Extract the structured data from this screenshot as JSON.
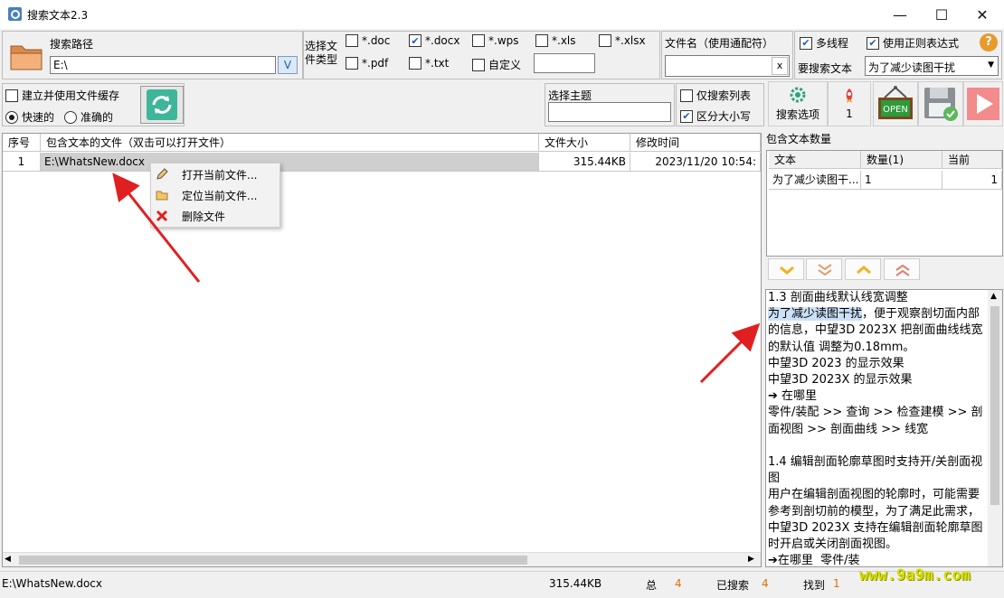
{
  "window": {
    "title": "搜索文本2.3",
    "minimize": "—",
    "maximize": "☐",
    "close": "✕"
  },
  "search_path": {
    "label": "搜索路径",
    "value": "E:\\",
    "dropdown_glyph": "V"
  },
  "file_types": {
    "label": "选择文件类型",
    "items": [
      {
        "label": "*.doc",
        "checked": false
      },
      {
        "label": "*.docx",
        "checked": true
      },
      {
        "label": "*.wps",
        "checked": false
      },
      {
        "label": "*.xls",
        "checked": false
      },
      {
        "label": "*.xlsx",
        "checked": false
      },
      {
        "label": "*.pdf",
        "checked": false
      },
      {
        "label": "*.txt",
        "checked": false
      },
      {
        "label": "自定义",
        "checked": false
      }
    ],
    "custom_value": ""
  },
  "filename_filter": {
    "label": "文件名（使用通配符）",
    "value": "",
    "clear": "x"
  },
  "options": {
    "multithread": {
      "label": "多线程",
      "checked": true
    },
    "regex": {
      "label": "使用正则表达式",
      "checked": true
    },
    "help": "?",
    "search_text_label": "要搜索文本",
    "search_text_value": "为了减少读图干扰"
  },
  "cache": {
    "label": "建立并使用文件缓存",
    "checked": false,
    "fast": "快速的",
    "accurate": "准确的",
    "mode": "fast"
  },
  "theme": {
    "label": "选择主题",
    "value": ""
  },
  "list_opts": {
    "only_list": {
      "label": "仅搜索列表",
      "checked": false
    },
    "case_sensitive": {
      "label": "区分大小写",
      "checked": true
    }
  },
  "toolbar": {
    "search_options": "搜索选项",
    "count": "1",
    "open_sign": "OPEN"
  },
  "results": {
    "columns": [
      "序号",
      "包含文本的文件（双击可以打开文件）",
      "文件大小",
      "修改时间"
    ],
    "rows": [
      {
        "index": "1",
        "file": "E:\\WhatsNew.docx",
        "size": "315.44KB",
        "modified": "2023/11/20 10:54:"
      }
    ]
  },
  "context_menu": {
    "items": [
      {
        "label": "打开当前文件...",
        "icon": "pencil-icon"
      },
      {
        "label": "定位当前文件...",
        "icon": "folder-icon"
      },
      {
        "label": "删除文件",
        "icon": "delete-x-icon"
      }
    ]
  },
  "count_panel": {
    "title": "包含文本数量",
    "columns": [
      "文本",
      "数量(1)",
      "当前"
    ],
    "rows": [
      {
        "text": "为了减少读图干...",
        "count": "1",
        "current": "1"
      }
    ]
  },
  "nav_buttons": [
    "chevron-down",
    "double-chevron-down",
    "chevron-up",
    "double-chevron-up"
  ],
  "text_preview": {
    "before": "1.3 剖面曲线默认线宽调整\n",
    "highlight": "为了减少读图干扰",
    "after": "，便于观察剖切面内部的信息，中望3D 2023X 把剖面曲线线宽的默认值 调整为0.18mm。\n中望3D 2023 的显示效果\n中望3D 2023X 的显示效果\n➔ 在哪里\n零件/装配 >> 查询 >> 检查建模 >> 剖面视图 >> 剖面曲线 >> 线宽\n\n1.4 编辑剖面轮廓草图时支持开/关剖面视图\n用户在编辑剖面视图的轮廓时，可能需要参考到剖切前的模型，为了满足此需求，中望3D 2023X 支持在编辑剖面轮廓草图时开启或关闭剖面视图。\n➔在哪里  零件/装"
  },
  "status": {
    "path": "E:\\WhatsNew.docx",
    "size": "315.44KB",
    "total_label": "总",
    "total": "4",
    "searched_label": "已搜索",
    "searched": "4",
    "found_label": "找到",
    "found": "1"
  },
  "watermark": "www.9a9m.com",
  "colors": {
    "accent_blue": "#1a5fb4",
    "status_orange": "#e07000",
    "selection_row": "#cfcfcf",
    "highlight": "#cce0f7",
    "arrow_red": "#e02020",
    "watermark": "#d8e000"
  }
}
